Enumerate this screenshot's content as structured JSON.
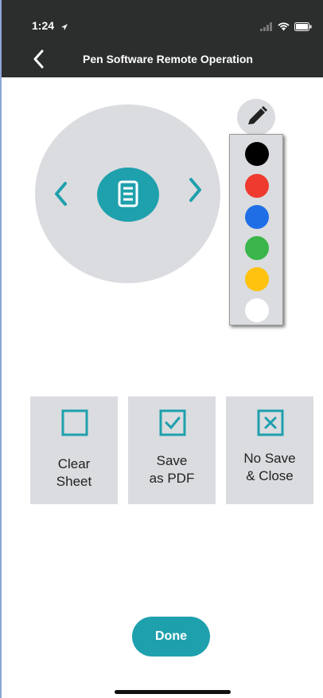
{
  "status_bar": {
    "time": "1:24"
  },
  "header": {
    "title": "Pen Software Remote Operation"
  },
  "colors": {
    "accent": "#1fa0ad",
    "dial": "#dadcdf",
    "header_bg": "#2b2e2c"
  },
  "palette": {
    "swatches": [
      {
        "name": "black",
        "color": "#000000"
      },
      {
        "name": "red",
        "color": "#ef3b2f"
      },
      {
        "name": "blue",
        "color": "#1f6ee6"
      },
      {
        "name": "green",
        "color": "#39b54a"
      },
      {
        "name": "yellow",
        "color": "#ffc20e"
      },
      {
        "name": "white",
        "color": "#ffffff"
      }
    ]
  },
  "actions": {
    "clear": {
      "label": "Clear\nSheet",
      "icon": "empty-square-icon"
    },
    "save_pdf": {
      "label": "Save\nas PDF",
      "icon": "checkbox-checked-icon"
    },
    "no_save": {
      "label": "No Save\n& Close",
      "icon": "checkbox-x-icon"
    }
  },
  "done_label": "Done"
}
